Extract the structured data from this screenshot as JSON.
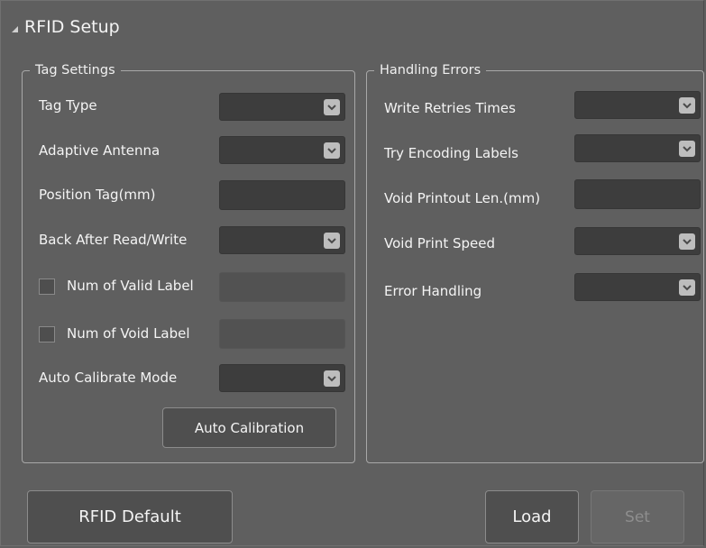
{
  "window": {
    "title": "RFID Setup"
  },
  "tag_settings": {
    "legend": "Tag Settings",
    "tag_type": {
      "label": "Tag Type",
      "value": ""
    },
    "adaptive_antenna": {
      "label": "Adaptive Antenna",
      "value": ""
    },
    "position_tag": {
      "label": "Position Tag(mm)",
      "value": ""
    },
    "back_after_rw": {
      "label": "Back After Read/Write",
      "value": ""
    },
    "num_valid_label": {
      "label": "Num of Valid Label",
      "checked": false,
      "value": ""
    },
    "num_void_label": {
      "label": "Num of Void Label",
      "checked": false,
      "value": ""
    },
    "auto_calibrate_mode": {
      "label": "Auto Calibrate Mode",
      "value": ""
    },
    "auto_calibration_button": "Auto Calibration"
  },
  "handling_errors": {
    "legend": "Handling Errors",
    "write_retries": {
      "label": "Write Retries Times",
      "value": ""
    },
    "try_encoding": {
      "label": "Try Encoding Labels",
      "value": ""
    },
    "void_printout_len": {
      "label": "Void Printout Len.(mm)",
      "value": ""
    },
    "void_print_speed": {
      "label": "Void Print Speed",
      "value": ""
    },
    "error_handling": {
      "label": "Error Handling",
      "value": ""
    }
  },
  "footer": {
    "rfid_default": "RFID Default",
    "load": "Load",
    "set": "Set"
  },
  "icons": {
    "collapse": "collapse-triangle-icon",
    "dropdown": "chevron-down-icon"
  },
  "colors": {
    "background": "#5f5f5f",
    "field": "#3d3d3d",
    "border": "#a8a8a8",
    "text": "#f2f2f2"
  }
}
